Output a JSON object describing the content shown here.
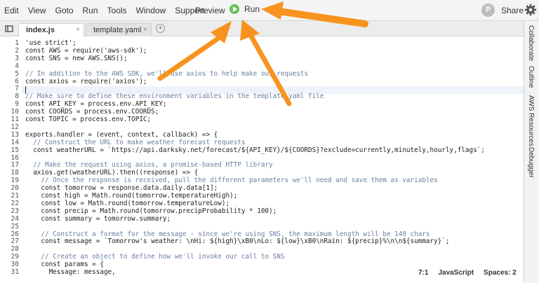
{
  "menu": [
    "Edit",
    "View",
    "Goto",
    "Run",
    "Tools",
    "Window",
    "Support"
  ],
  "toolbar": {
    "preview": "Preview",
    "run": "Run",
    "share": "Share",
    "avatar_letter": "P"
  },
  "tabs": [
    {
      "label": "index.js",
      "active": true
    },
    {
      "label": "template.yaml",
      "active": false
    }
  ],
  "close_glyph": "×",
  "add_glyph": "+",
  "right_tabs": [
    "Collaborate",
    "Outline",
    "AWS Resources",
    "Debugger"
  ],
  "status": {
    "position": "7:1",
    "language": "JavaScript",
    "spaces": "Spaces: 2"
  },
  "code": {
    "lines": [
      "'use strict';",
      "const AWS = require('aws-sdk');",
      "const SNS = new AWS.SNS();",
      "",
      "// In addition to the AWS SDK, we'll use axios to help make our requests",
      "const axios = require('axios');",
      "",
      "// Make sure to define these environment variables in the template.yaml file",
      "const API_KEY = process.env.API_KEY;",
      "const COORDS = process.env.COORDS;",
      "const TOPIC = process.env.TOPIC;",
      "",
      "exports.handler = (event, context, callback) => {",
      "  // Construct the URL to make weather forecast requests",
      "  const weatherURL = `https://api.darksky.net/forecast/${API_KEY}/${COORDS}?exclude=currently,minutely,hourly,flags`;",
      "",
      "  // Make the request using axios, a promise-based HTTP library",
      "  axios.get(weatherURL).then((response) => {",
      "    // Once the response is received, pull the different parameters we'll need and save them as variables",
      "    const tomorrow = response.data.daily.data[1];",
      "    const high = Math.round(tomorrow.temperatureHigh);",
      "    const low = Math.round(tomorrow.temperatureLow);",
      "    const precip = Math.round(tomorrow.precipProbability * 100);",
      "    const summary = tomorrow.summary;",
      "",
      "    // Construct a format for the message - since we're using SNS, the maximum length will be 140 chars",
      "    const message = `Tomorrow's weather: \\nHi: ${high}\\xB0\\nLo: ${low}\\xB0\\nRain: ${precip}%\\n\\n${summary}`;",
      "",
      "    // Create an object to define how we'll invoke our call to SNS",
      "    const params = {",
      "      Message: message,"
    ]
  },
  "colors": {
    "run_green": "#6bbf59",
    "arrow_orange": "#f7931e",
    "comment": "#6a7fa0",
    "keyword": "#1a3fb5",
    "string": "#a0501a"
  }
}
